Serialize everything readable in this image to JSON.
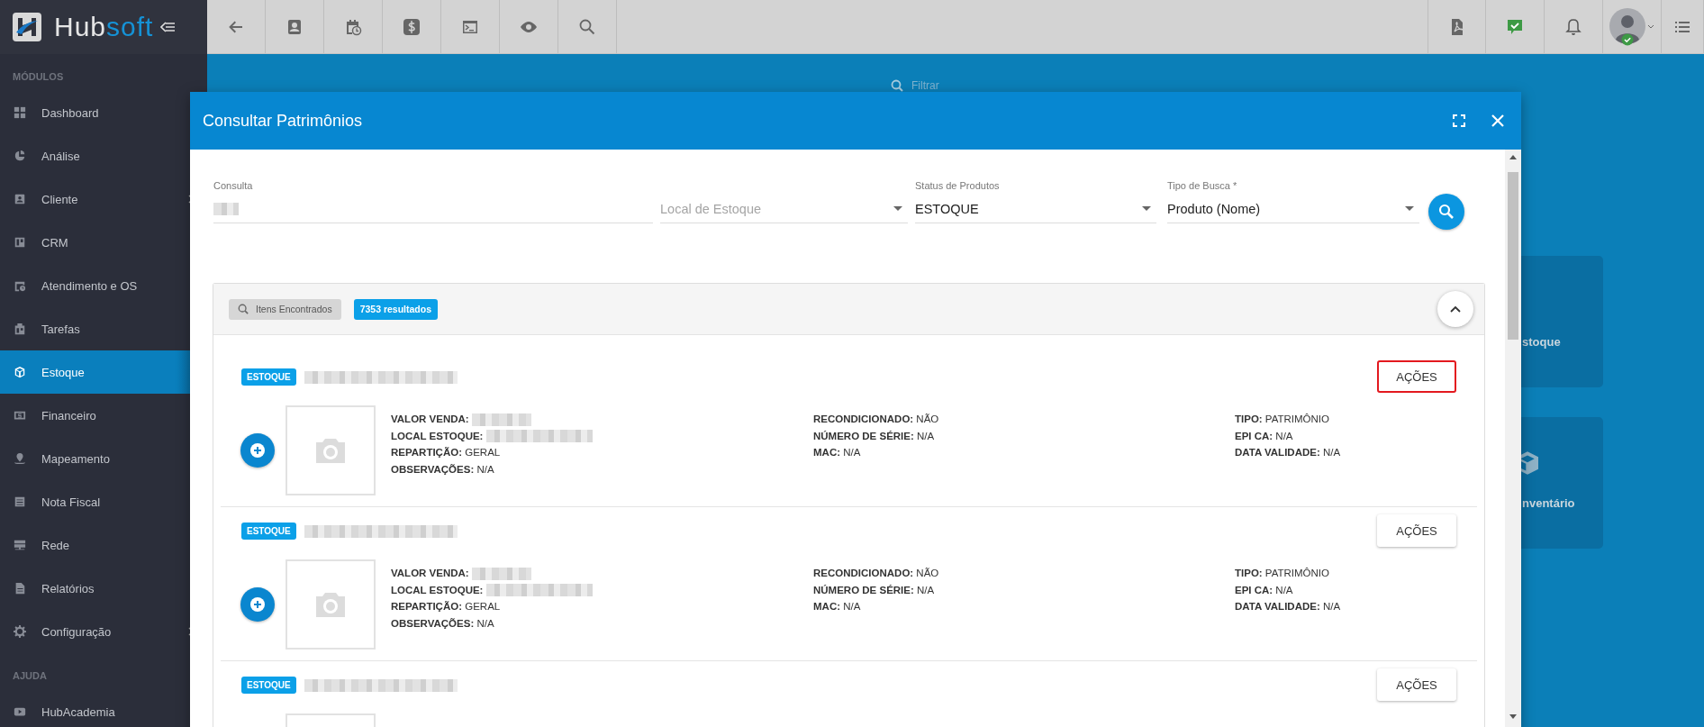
{
  "brand": {
    "name": "Hub",
    "accent": "soft"
  },
  "sidebar": {
    "sections": [
      {
        "title": "MÓDULOS",
        "items": [
          {
            "label": "Dashboard",
            "selected": false,
            "has_submenu": false
          },
          {
            "label": "Análise",
            "selected": false,
            "has_submenu": false
          },
          {
            "label": "Cliente",
            "selected": false,
            "has_submenu": true
          },
          {
            "label": "CRM",
            "selected": false,
            "has_submenu": false
          },
          {
            "label": "Atendimento e OS",
            "selected": false,
            "has_submenu": false
          },
          {
            "label": "Tarefas",
            "selected": false,
            "has_submenu": false
          },
          {
            "label": "Estoque",
            "selected": true,
            "has_submenu": false
          },
          {
            "label": "Financeiro",
            "selected": false,
            "has_submenu": false
          },
          {
            "label": "Mapeamento",
            "selected": false,
            "has_submenu": false
          },
          {
            "label": "Nota Fiscal",
            "selected": false,
            "has_submenu": false
          },
          {
            "label": "Rede",
            "selected": false,
            "has_submenu": false
          },
          {
            "label": "Relatórios",
            "selected": false,
            "has_submenu": false
          },
          {
            "label": "Configuração",
            "selected": false,
            "has_submenu": true
          }
        ]
      },
      {
        "title": "AJUDA",
        "items": [
          {
            "label": "HubAcademia",
            "selected": false,
            "has_submenu": false
          }
        ]
      }
    ]
  },
  "background": {
    "filter_placeholder": "Filtrar",
    "tiles": [
      {
        "label": "stoque"
      },
      {
        "label": "nventário"
      }
    ]
  },
  "modal": {
    "title": "Consultar Patrimônios",
    "form": {
      "fields": [
        {
          "kind": "text",
          "label": "Consulta",
          "redacted": true
        },
        {
          "kind": "select",
          "placeholder": "Local de Estoque"
        },
        {
          "kind": "select",
          "label": "Status de Produtos",
          "value": "ESTOQUE"
        },
        {
          "kind": "select",
          "label": "Tipo de Busca *",
          "value": "Produto (Nome)"
        }
      ]
    },
    "results": {
      "chip": "Itens Encontrados",
      "count": "7353 resultados",
      "expanded": true,
      "items": [
        {
          "tag": "ESTOQUE",
          "action": "AÇÕES",
          "highlighted": true,
          "columns": [
            [
              {
                "label": "VALOR VENDA:",
                "redacted": true
              },
              {
                "label": "LOCAL ESTOQUE:",
                "redacted": true
              },
              {
                "label": "REPARTIÇÃO:",
                "value": "GERAL"
              },
              {
                "label": "OBSERVAÇÕES:",
                "value": "N/A"
              }
            ],
            [
              {
                "label": "RECONDICIONADO:",
                "value": "NÃO"
              },
              {
                "label": "NÚMERO DE SÉRIE:",
                "value": "N/A"
              },
              {
                "label": "MAC:",
                "value": "N/A"
              }
            ],
            [
              {
                "label": "TIPO:",
                "value": "PATRIMÔNIO"
              },
              {
                "label": "EPI CA:",
                "value": "N/A"
              },
              {
                "label": "DATA VALIDADE:",
                "value": "N/A"
              }
            ]
          ]
        },
        {
          "tag": "ESTOQUE",
          "action": "AÇÕES",
          "highlighted": false,
          "columns": [
            [
              {
                "label": "VALOR VENDA:",
                "redacted": true
              },
              {
                "label": "LOCAL ESTOQUE:",
                "redacted": true
              },
              {
                "label": "REPARTIÇÃO:",
                "value": "GERAL"
              },
              {
                "label": "OBSERVAÇÕES:",
                "value": "N/A"
              }
            ],
            [
              {
                "label": "RECONDICIONADO:",
                "value": "NÃO"
              },
              {
                "label": "NÚMERO DE SÉRIE:",
                "value": "N/A"
              },
              {
                "label": "MAC:",
                "value": "N/A"
              }
            ],
            [
              {
                "label": "TIPO:",
                "value": "PATRIMÔNIO"
              },
              {
                "label": "EPI CA:",
                "value": "N/A"
              },
              {
                "label": "DATA VALIDADE:",
                "value": "N/A"
              }
            ]
          ]
        },
        {
          "tag": "ESTOQUE",
          "action": "AÇÕES",
          "highlighted": false
        }
      ]
    }
  }
}
